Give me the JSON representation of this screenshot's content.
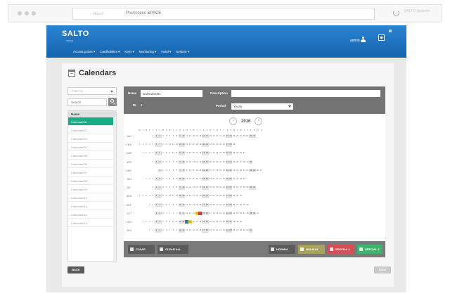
{
  "browser": {
    "url_host": "https://",
    "url_path": "ProAccess SPACE",
    "search_placeholder": "SALTO Systems"
  },
  "header": {
    "logo": "SALTO",
    "logo_sub": "SPACE",
    "user": "admin",
    "menu": [
      "Access points ▾",
      "Cardholders ▾",
      "Keys ▾",
      "Monitoring ▾",
      "Hotel ▾",
      "System ▾"
    ]
  },
  "page": {
    "title": "Calendars",
    "filter_placeholder": "Filter by",
    "search_placeholder": "Search"
  },
  "list": {
    "header": "Name",
    "items": [
      "Calendar001",
      "Calendar002",
      "Calendar003",
      "Calendar004",
      "Calendar005",
      "Calendar006",
      "Calendar007",
      "Calendar008",
      "Calendar009",
      "Calendar010",
      "Calendar011",
      "Calendar012",
      "Calendar013"
    ],
    "active_index": 0
  },
  "form": {
    "name_label": "Name",
    "name_value": "Calendar001",
    "id_label": "ID",
    "id_value": "1",
    "description_label": "Description",
    "description_value": "",
    "period_label": "Period",
    "period_value": "Yearly"
  },
  "calendar": {
    "year": "2016",
    "prev": "‹",
    "next": "›",
    "dow": [
      "M",
      "T",
      "W",
      "T",
      "F",
      "S",
      "S"
    ],
    "months": [
      "JAN",
      "FEB",
      "MAR",
      "APR",
      "MAY",
      "JUN",
      "JUL",
      "AUG",
      "SEP",
      "OCT",
      "NOV",
      "DEC"
    ],
    "highlights": {
      "red": [
        [
          9,
          14
        ]
      ],
      "yellow": [
        [
          9,
          13
        ],
        [
          10,
          15
        ]
      ],
      "blue": [
        [
          10,
          14
        ]
      ]
    },
    "colors": {
      "weekend": "#e3e3e3",
      "red": "#d33a3a",
      "yellow": "#e9d32f",
      "blue": "#2e78c7"
    }
  },
  "footer": {
    "clear": "CLEAR",
    "clear_all": "CLEAR ALL",
    "normal": "NORMAL",
    "holiday": "HOLIDAY",
    "special1": "SPECIAL 1",
    "special2": "SPECIAL 2"
  },
  "actions": {
    "back": "BACK",
    "save": "SAVE"
  }
}
